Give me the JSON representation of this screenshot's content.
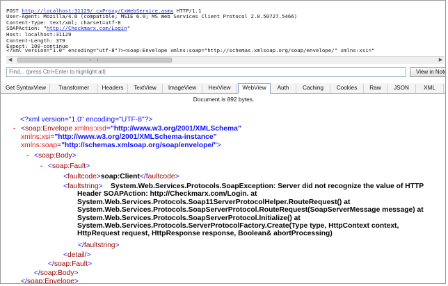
{
  "request": {
    "method_line_prefix": "POST ",
    "url": "http://localhost:31129/_cxProxy/CxWebService.asmx",
    "method_line_suffix": " HTTP/1.1",
    "user_agent": "User-Agent: Mozilla/4.0 (compatible; MSIE 6.0; MS Web Services Client Protocol 2.0.50727.5466)",
    "content_type": "Content-Type: text/xml; charset=utf-8",
    "soapaction_prefix": "SOAPAction: \"",
    "soapaction_url": "http://Checkmarx.com/Login",
    "soapaction_suffix": "\"",
    "host": "Host: localhost:31129",
    "content_length": "Content-Length: 379",
    "expect": "Expect: 100-continue",
    "body_preview": "<?xml version=\"1.0\" encoding=\"utf-8\"?><soap:Envelope xmlns:soap=\"http://schemas.xmlsoap.org/soap/envelope/\" xmlns:xsi=\""
  },
  "find": {
    "placeholder": "Find... (press Ctrl+Enter to highlight all)",
    "button_label": "View in Notepad"
  },
  "tabs": [
    {
      "label": "Get SyntaxView"
    },
    {
      "label": "Transformer"
    },
    {
      "label": "Headers"
    },
    {
      "label": "TextView"
    },
    {
      "label": "ImageView"
    },
    {
      "label": "HexView"
    },
    {
      "label": "WebView"
    },
    {
      "label": "Auth"
    },
    {
      "label": "Caching"
    },
    {
      "label": "Cookies"
    },
    {
      "label": "Raw"
    },
    {
      "label": "JSON"
    },
    {
      "label": "XML"
    }
  ],
  "active_tab": "WebView",
  "document_info": "Document is 892 bytes.",
  "xml": {
    "collapse_marker": "-",
    "decl": "<?xml version=\"1.0\" encoding=\"UTF-8\"?>",
    "lt": "<",
    "gt": ">",
    "lt_slash": "</",
    "self_close": "/>",
    "eq": "=",
    "envelope": "soap:Envelope",
    "xsd_attr": "xmlns:xsd",
    "xsd_val": "\"http://www.w3.org/2001/XMLSchema\"",
    "xsi_attr": "xmlns:xsi",
    "xsi_val": "\"http://www.w3.org/2001/XMLSchema-instance\"",
    "soap_attr": "xmlns:soap",
    "soap_val": "\"http://schemas.xmlsoap.org/soap/envelope/\"",
    "body": "soap:Body",
    "fault": "soap:Fault",
    "faultcode": "faultcode",
    "faultcode_value": "soap:Client",
    "faultstring": "faultstring",
    "faultstring_value": "System.Web.Services.Protocols.SoapException: Server did not recognize the value of HTTP Header SOAPAction: http://Checkmarx.com/Login. at System.Web.Services.Protocols.Soap11ServerProtocolHelper.RouteRequest() at System.Web.Services.Protocols.SoapServerProtocol.RouteRequest(SoapServerMessage message) at System.Web.Services.Protocols.SoapServerProtocol.Initialize() at System.Web.Services.Protocols.ServerProtocolFactory.Create(Type type, HttpContext context, HttpRequest request, HttpResponse response, Boolean& abortProcessing)",
    "detail": "detail"
  },
  "colors": {
    "markup_brackets": "#1010ff",
    "tag_names": "#990000",
    "attribute_names": "#e01a1a",
    "attribute_values": "#1010ff",
    "collapse_markers": "#e01a1a"
  }
}
